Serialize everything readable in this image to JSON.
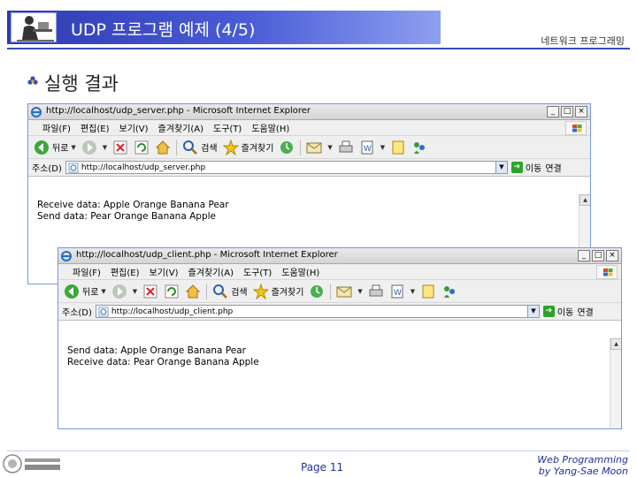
{
  "slide": {
    "title": "UDP 프로그램 예제 (4/5)",
    "course": "네트워크 프로그래밍",
    "heading": "실행 결과",
    "page": "Page 11",
    "credit_line1": "Web Programming",
    "credit_line2": "by Yang-Sae Moon"
  },
  "server_window": {
    "title": "http://localhost/udp_server.php - Microsoft Internet Explorer",
    "menu": [
      "파일(F)",
      "편집(E)",
      "보기(V)",
      "즐겨찾기(A)",
      "도구(T)",
      "도움말(H)"
    ],
    "toolbar": {
      "back": "뒤로",
      "search": "검색",
      "favorites": "즐겨찾기"
    },
    "address_label": "주소(D)",
    "address": "http://localhost/udp_server.php",
    "go": "이동",
    "links": "연결",
    "output": [
      "Receive data: Apple Orange Banana Pear",
      "Send data: Pear Orange Banana Apple"
    ]
  },
  "client_window": {
    "title": "http://localhost/udp_client.php - Microsoft Internet Explorer",
    "menu": [
      "파일(F)",
      "편집(E)",
      "보기(V)",
      "즐겨찾기(A)",
      "도구(T)",
      "도움말(H)"
    ],
    "toolbar": {
      "back": "뒤로",
      "search": "검색",
      "favorites": "즐겨찾기"
    },
    "address_label": "주소(D)",
    "address": "http://localhost/udp_client.php",
    "go": "이동",
    "links": "연결",
    "output": [
      "Send data: Apple Orange Banana Pear",
      "Receive data: Pear Orange Banana Apple"
    ]
  },
  "icons": {
    "title_logo": "presenter-at-desk-icon",
    "bullet": "flower-bullet-icon",
    "footer_logo": "university-seal-icon"
  },
  "colors": {
    "title_bar": "#3444c4",
    "accent_text": "#1f2f9e",
    "ie_border": "#7a96df"
  }
}
